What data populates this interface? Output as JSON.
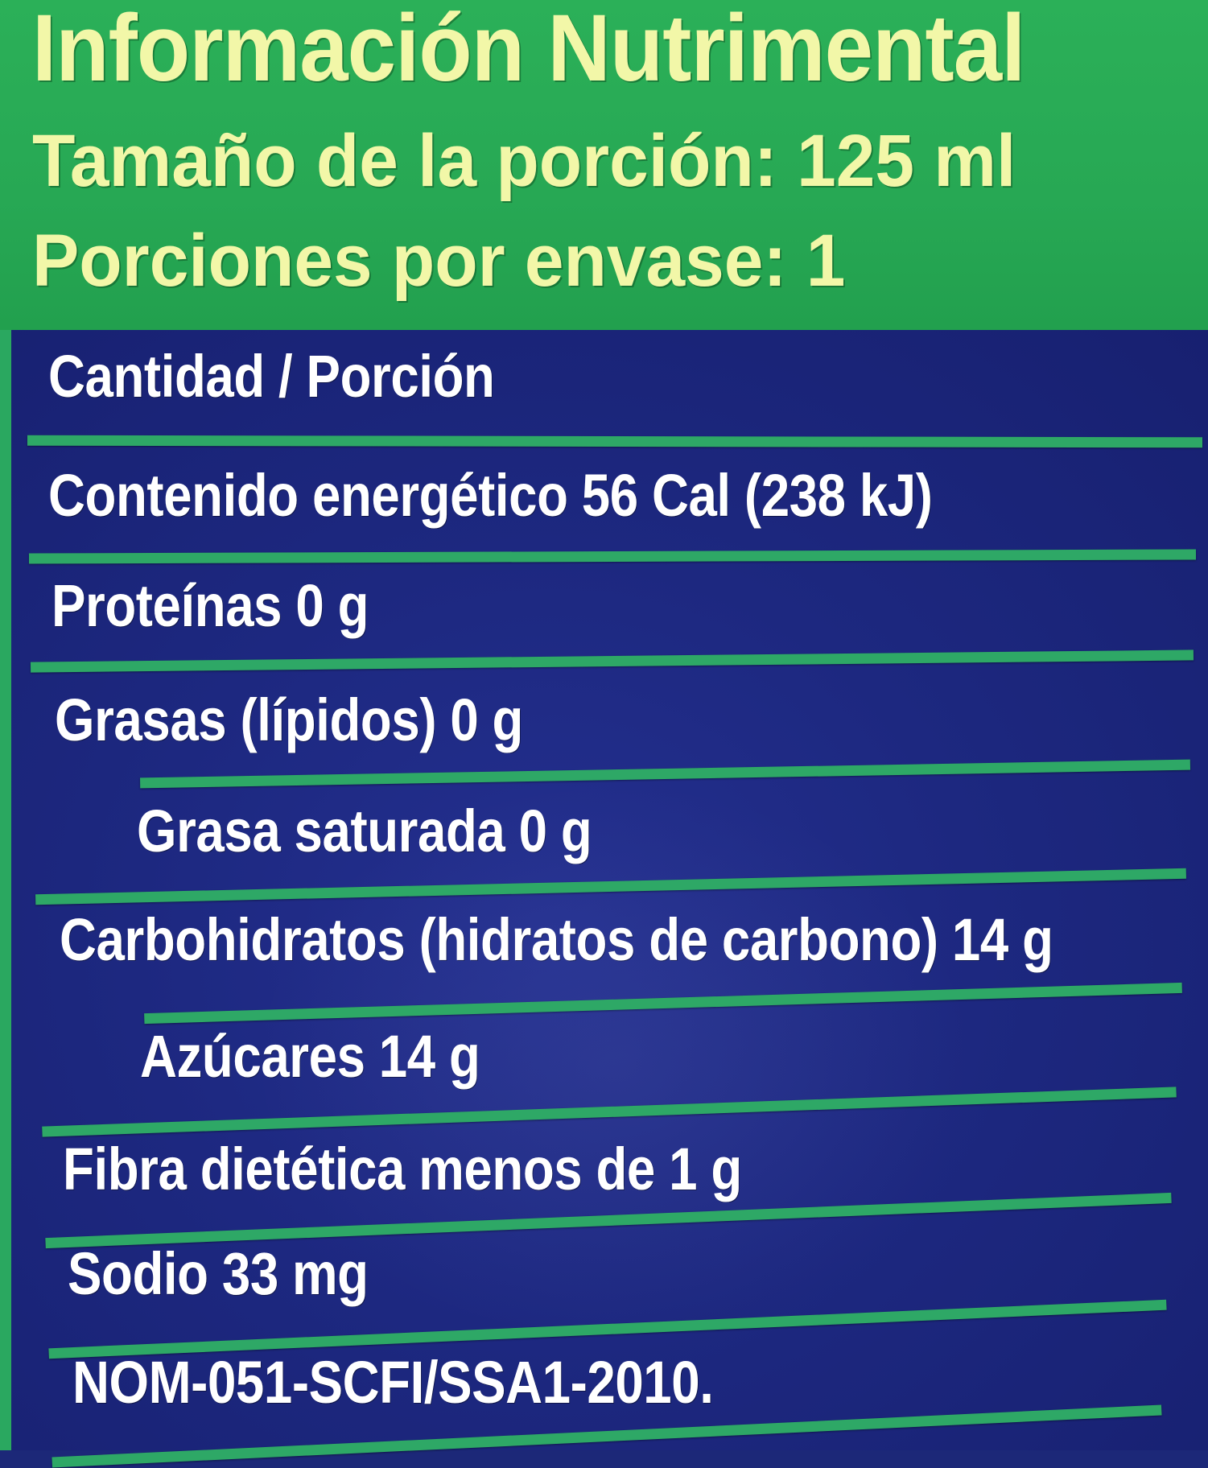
{
  "header": {
    "title": "Información Nutrimental",
    "serving_size": "Tamaño de la porción: 125 ml",
    "servings_per_container": "Porciones por envase: 1"
  },
  "panel": {
    "amount_per_serving": "Cantidad / Porción",
    "rows": [
      "Contenido energético 56 Cal (238 kJ)",
      "Proteínas 0 g",
      "Grasas (lípidos) 0 g",
      "Grasa saturada 0 g",
      "Carbohidratos (hidratos de carbono) 14 g",
      "Azúcares 14 g",
      "Fibra dietética menos de  1 g",
      "Sodio 33 mg",
      "NOM-051-SCFI/SSA1-2010."
    ]
  },
  "colors": {
    "header_bg": "#27a854",
    "header_text": "#f2f7a8",
    "panel_bg": "#1d2880",
    "rule": "#2ea866",
    "panel_text": "#ffffff"
  }
}
